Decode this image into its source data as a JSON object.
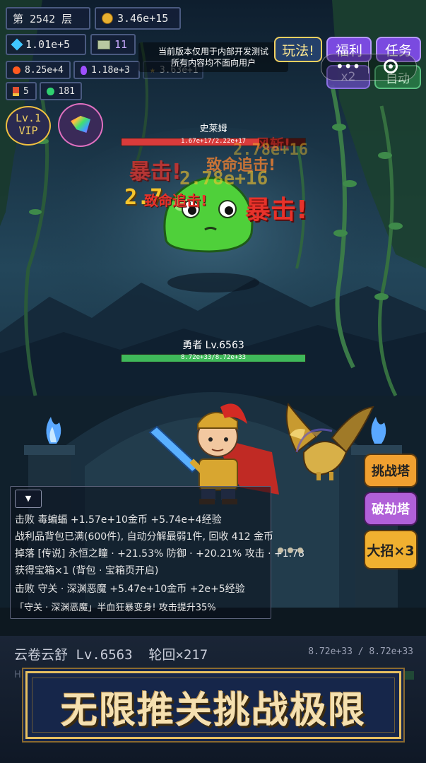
{
  "hud": {
    "floor": "第 2542 层",
    "gold": "3.46e+15",
    "diamonds": "1.01e+5",
    "tickets": "11",
    "fire": "8.25e+4",
    "potion": "1.18e+3",
    "stars": "3.63e+1",
    "medals": "5",
    "orbs": "181",
    "vip_level": "Lv.1",
    "vip_label": "VIP"
  },
  "notice": {
    "line1": "当前版本仅用于内部开发测试",
    "line2": "所有内容均不面向用户"
  },
  "top_buttons": {
    "gameplay": "玩法!",
    "welfare": "福利",
    "tasks": "任务",
    "speed": "x2",
    "auto": "自动"
  },
  "enemy": {
    "name": "史莱姆",
    "hp_text": "1.67e+17/2.22e+17",
    "hp_fraction": 0.75,
    "damage_numbers": [
      "2.78e+16",
      "2.78e+16",
      "2.7"
    ],
    "crit_texts": [
      "暴击!",
      "暴击!",
      "致命追击!",
      "致命追击!",
      "风斩!"
    ]
  },
  "hero": {
    "name_level": "勇者 Lv.6563",
    "hp_text": "8.72e+33/8.72e+33",
    "hp_fraction": 1.0
  },
  "side_buttons": {
    "challenge_tower": "挑战塔",
    "break_tower": "破劫塔",
    "ultimate": "大招×3"
  },
  "battle_log": [
    "击败 毒蝙蝠  +1.57e+10金币 +5.74e+4经验",
    "战利品背包已满(600件), 自动分解最弱1件, 回收 412 金币",
    "掉落 [传说] 永恒之瞳 · +21.53% 防御 · +20.21% 攻击 · +1.78",
    "获得宝箱×1 (背包 · 宝箱页开启)",
    "击败 守关 · 深渊恶魔  +5.47e+10金币 +2e+5经验",
    "「守关 · 深渊恶魔」半血狂暴变身! 攻击提升35%"
  ],
  "player_bar": {
    "name": "云卷云舒 Lv.6563  轮回×217",
    "hp_text": "8.72e+33 / 8.72e+33",
    "hp_label": "HP"
  },
  "banner": {
    "text": "无限推关挑战极限"
  },
  "colors": {
    "slime": "#4fd03a",
    "enemy_hp": "#d93b3b",
    "hero_hp": "#3fb95a",
    "crit_red": "#e8322a",
    "damage_yellow": "#f6c52c",
    "banner_gold": "#e8c060",
    "banner_bg": "#16264a"
  }
}
